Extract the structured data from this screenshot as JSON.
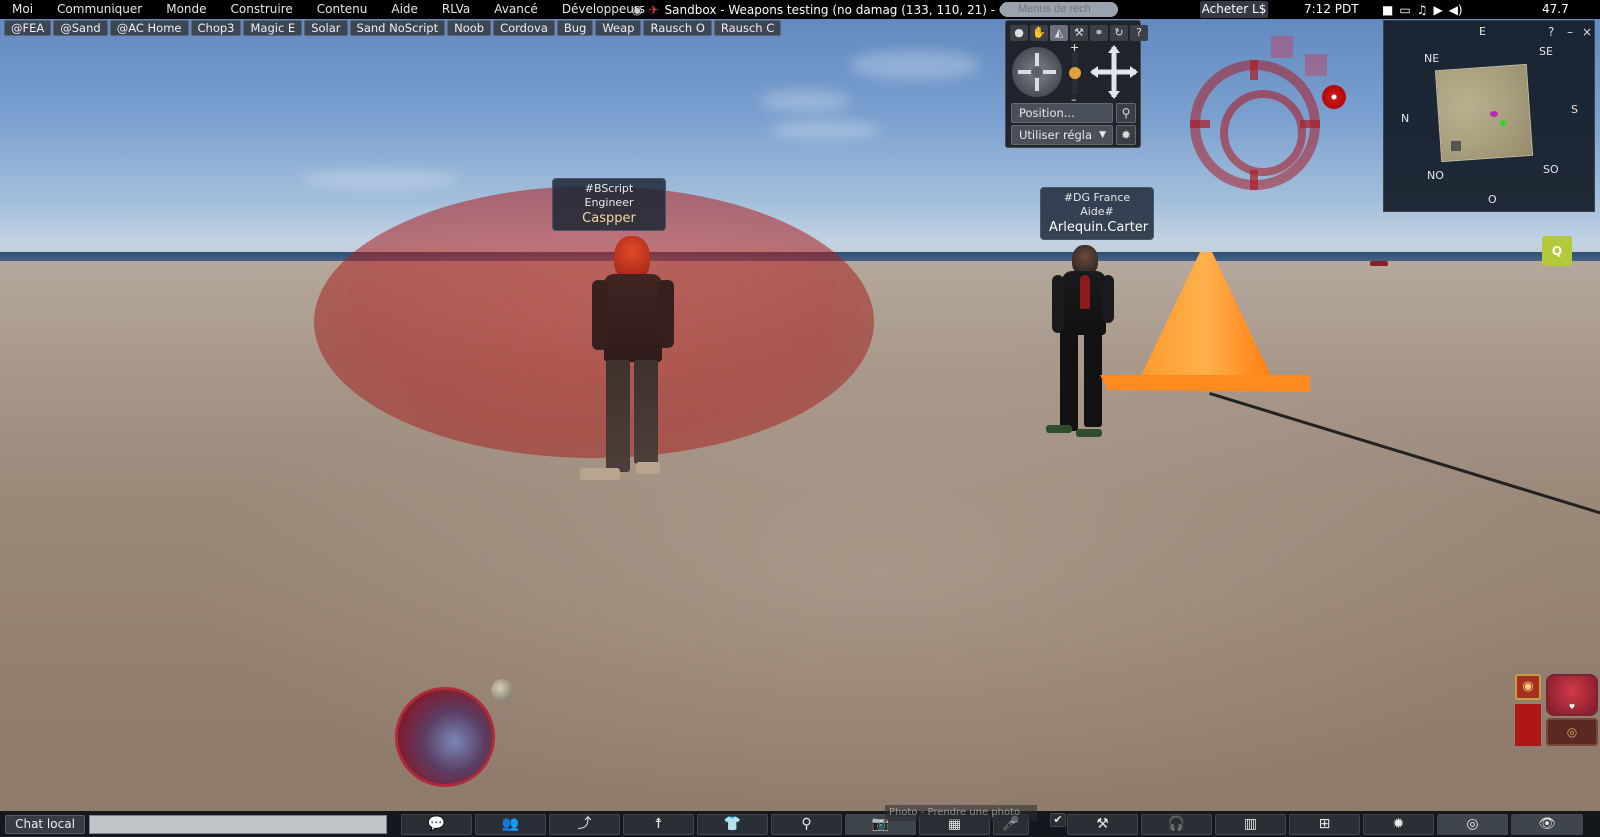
{
  "menu": {
    "items": [
      "Moi",
      "Communiquer",
      "Monde",
      "Construire",
      "Contenu",
      "Aide",
      "RLVa",
      "Avancé",
      "Développeurs"
    ],
    "title": "Sandbox - Weapons testing (no damag (133, 110, 21) - Gé",
    "search_placeholder": "Menus de rech",
    "buy_label": "Acheter L$",
    "clock": "7:12  PDT",
    "fps": "47.7"
  },
  "favorites": [
    "@FEA",
    "@Sand",
    "@AC Home",
    "Chop3",
    "Magic E",
    "Solar",
    "Sand NoScript",
    "Noob",
    "Cordova",
    "Bug",
    "Weap",
    "Rausch O",
    "Rausch C"
  ],
  "camera_panel": {
    "position_label": "Position...",
    "preset_label": "Utiliser régla",
    "tabs": [
      "person-icon",
      "hand-icon",
      "body-icon",
      "tool-icon",
      "link-icon",
      "reset-icon",
      "help-icon"
    ]
  },
  "minimap": {
    "compass": {
      "n": "N",
      "ne": "NE",
      "e": "E",
      "se": "SE",
      "s": "S",
      "so": "SO",
      "o": "O",
      "no": "NO"
    },
    "help": "?",
    "minimize": "–",
    "close": "×"
  },
  "nametags": {
    "caspper": {
      "group": "#BScript Engineer",
      "name": "Caspper"
    },
    "arlequin": {
      "group": "#DG France Aide#",
      "name": "Arlequin.Carter"
    }
  },
  "bottom": {
    "chat_label": "Chat local",
    "chat_value": "",
    "tooltip": "Photo - Prendre une photo",
    "toolbar": [
      "chat-icon",
      "people-icon",
      "walk-icon",
      "fly-icon",
      "appearance-icon",
      "search-icon",
      "camera-snapshot-icon",
      "inventory-icon",
      "voice-icon",
      "build-icon",
      "headphones-icon",
      "map-icon",
      "minimap-icon",
      "aperture-icon",
      "radar-icon",
      "eye-icon"
    ]
  },
  "colors": {
    "menu_bg": "#000000",
    "panel_bg": "#1c1e22",
    "accent_red": "#b02a3a",
    "cone_orange": "#ff8a1f"
  }
}
